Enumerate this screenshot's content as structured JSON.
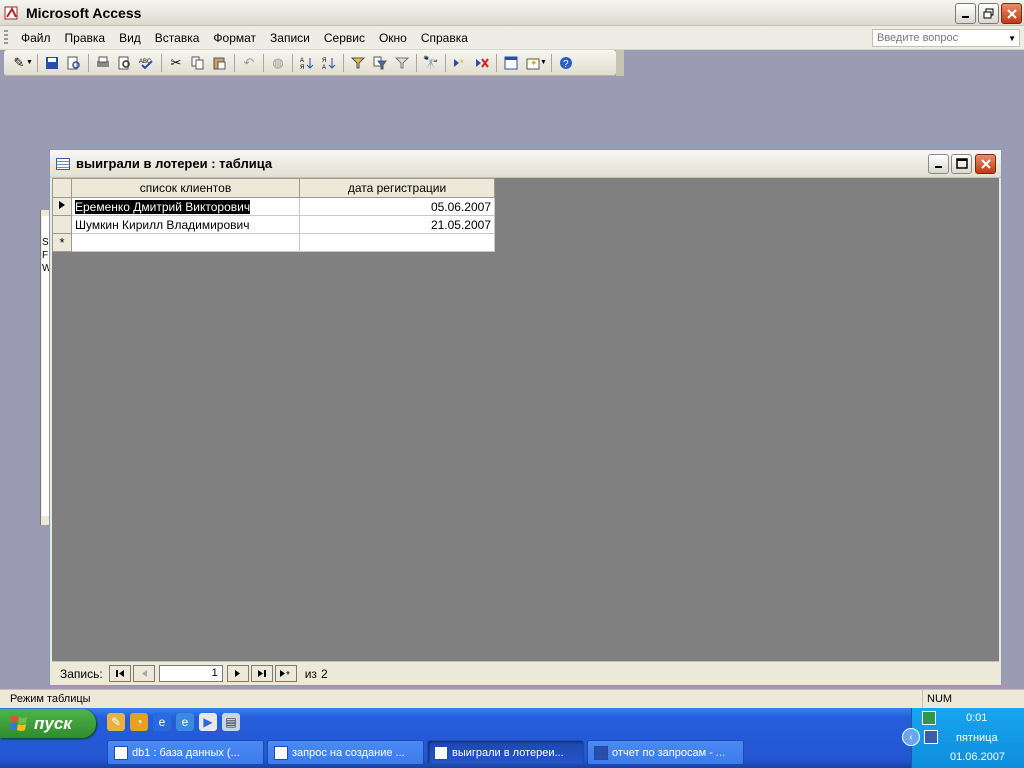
{
  "app": {
    "title": "Microsoft Access"
  },
  "menu": {
    "items": [
      "Файл",
      "Правка",
      "Вид",
      "Вставка",
      "Формат",
      "Записи",
      "Сервис",
      "Окно",
      "Справка"
    ],
    "ask_placeholder": "Введите вопрос"
  },
  "toolbar": {
    "icons": [
      "design-view-icon",
      "save-icon",
      "search-icon",
      "print-icon",
      "print-preview-icon",
      "spelling-icon",
      "cut-icon",
      "copy-icon",
      "paste-icon",
      "undo-icon",
      "insert-hyperlink-icon",
      "sort-ascending-icon",
      "sort-descending-icon",
      "filter-by-selection-icon",
      "filter-by-form-icon",
      "apply-filter-icon",
      "find-icon",
      "new-record-icon",
      "delete-record-icon",
      "database-window-icon",
      "new-object-icon",
      "help-icon"
    ]
  },
  "child_window": {
    "title": "выиграли в лотереи : таблица",
    "columns": [
      "список клиентов",
      "дата регистрации"
    ],
    "rows": [
      {
        "client": "Еременко Дмитрий Викторович",
        "date": "05.06.2007"
      },
      {
        "client": "Шумкин Кирилл Владимирович",
        "date": "21.05.2007"
      }
    ],
    "new_row_marker": "*",
    "nav": {
      "label": "Запись:",
      "current": "1",
      "of_label": "из",
      "total": "2"
    }
  },
  "background_window": {
    "letters": "S\nF\nW"
  },
  "status": {
    "mode": "Режим таблицы",
    "num": "NUM"
  },
  "taskbar": {
    "start_label": "пуск",
    "tasks": [
      {
        "label": "db1 : база данных (..."
      },
      {
        "label": "запрос на создание ..."
      },
      {
        "label": "выиграли в лотереи..."
      },
      {
        "label": "отчет по запросам - ..."
      }
    ],
    "time": "0:01",
    "day": "пятница",
    "date": "01.06.2007"
  }
}
